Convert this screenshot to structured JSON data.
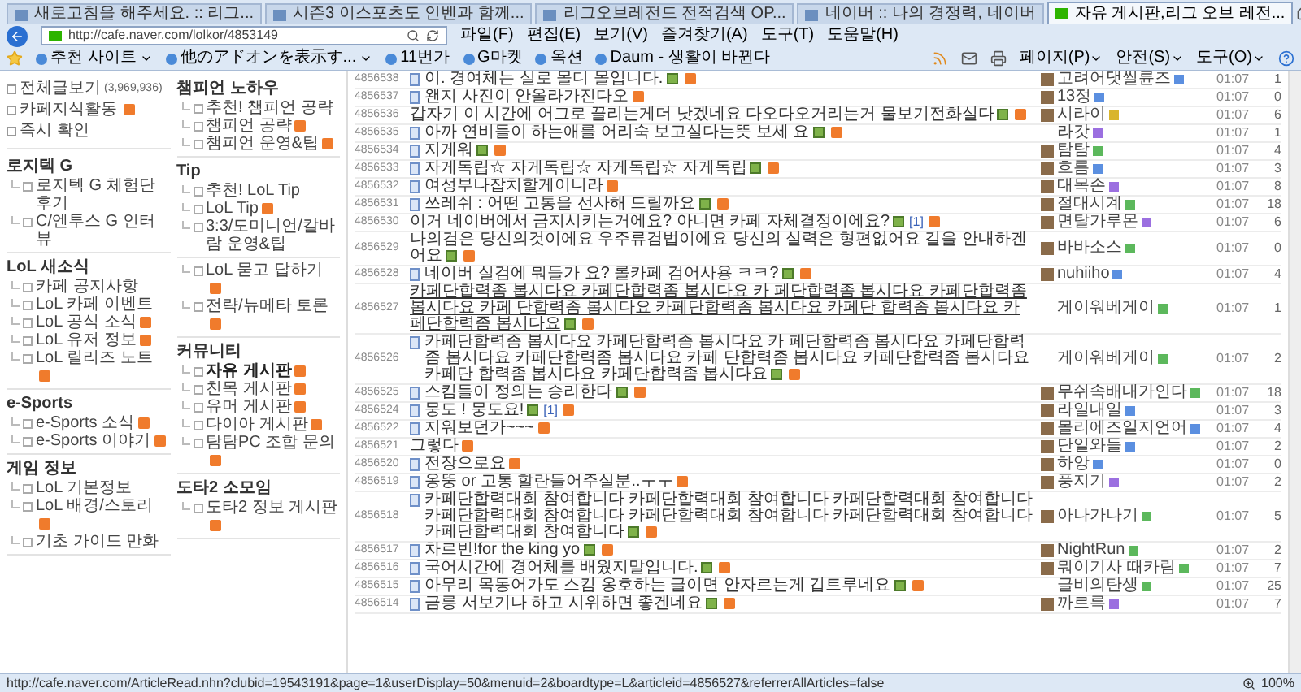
{
  "browser": {
    "tabs": [
      {
        "title": "새로고침을 해주세요. :: 리그...",
        "selected": false
      },
      {
        "title": "시즌3 이스포츠도 인벤과 함께...",
        "selected": false
      },
      {
        "title": "리그오브레전드 전적검색 OP...",
        "selected": false
      },
      {
        "title": "네이버 :: 나의 경쟁력, 네이버",
        "selected": false
      },
      {
        "title": "자유 게시판,리그 오브 레전...",
        "selected": true
      }
    ],
    "address": "http://cafe.naver.com/lolkor/4853149",
    "menu": [
      "파일(F)",
      "편집(E)",
      "보기(V)",
      "즐겨찾기(A)",
      "도구(T)",
      "도움말(H)"
    ],
    "favorites": [
      {
        "label": "추천 사이트",
        "dropdown": true
      },
      {
        "label": "他のアドオンを表示す...",
        "dropdown": true
      },
      {
        "label": "11번가",
        "dropdown": false
      },
      {
        "label": "G마켓",
        "dropdown": false
      },
      {
        "label": "옥션",
        "dropdown": false
      },
      {
        "label": "Daum - 생활이 바뀐다",
        "dropdown": false
      }
    ],
    "tools": [
      "페이지(P)",
      "안전(S)",
      "도구(O)"
    ]
  },
  "sidebar": {
    "top": [
      {
        "label": "전체글보기",
        "count": "(3,969,936)",
        "new": false
      },
      {
        "label": "카페지식활동",
        "new": true
      },
      {
        "label": "즉시 확인",
        "new": false
      }
    ],
    "groups": [
      {
        "title": "로지텍 G",
        "items": [
          {
            "label": "로지텍 G 체험단 후기",
            "new": false,
            "selected": false
          },
          {
            "label": "C/엔투스 G 인터뷰",
            "new": false,
            "selected": false
          }
        ]
      },
      {
        "title": "LoL 새소식",
        "items": [
          {
            "label": "카페 공지사항",
            "new": false,
            "selected": false
          },
          {
            "label": "LoL 카페 이벤트",
            "new": false,
            "selected": false
          },
          {
            "label": "LoL 공식 소식",
            "new": true,
            "selected": false
          },
          {
            "label": "LoL 유저 정보",
            "new": true,
            "selected": false
          },
          {
            "label": "LoL 릴리즈 노트",
            "new": true,
            "selected": false
          }
        ]
      },
      {
        "title": "e-Sports",
        "items": [
          {
            "label": "e-Sports 소식",
            "new": true,
            "selected": false
          },
          {
            "label": "e-Sports 이야기",
            "new": true,
            "selected": false
          }
        ]
      },
      {
        "title": "게임 정보",
        "items": [
          {
            "label": "LoL 기본정보",
            "new": false,
            "selected": false
          },
          {
            "label": "LoL 배경/스토리",
            "new": true,
            "selected": false
          },
          {
            "label": "기초 가이드 만화",
            "new": false,
            "selected": false
          }
        ]
      },
      {
        "title": "챔피언 노하우",
        "items": [
          {
            "label": "추천! 챔피언 공략",
            "new": false,
            "selected": false
          },
          {
            "label": "챔피언 공략",
            "new": true,
            "selected": false
          },
          {
            "label": "챔피언 운영&팁",
            "new": true,
            "selected": false
          }
        ]
      },
      {
        "title": "Tip",
        "items": [
          {
            "label": "추천! LoL Tip",
            "new": false,
            "selected": false
          },
          {
            "label": "LoL Tip",
            "new": true,
            "selected": false
          },
          {
            "label": "3:3/도미니언/칼바람 운영&팁",
            "new": false,
            "selected": false
          }
        ]
      },
      {
        "items": [
          {
            "label": "LoL 묻고 답하기",
            "new": true,
            "selected": false
          },
          {
            "label": "전략/뉴메타 토론",
            "new": true,
            "selected": false
          }
        ]
      },
      {
        "title": "커뮤니티",
        "items": [
          {
            "label": "자유 게시판",
            "new": true,
            "selected": true
          },
          {
            "label": "친목 게시판",
            "new": true,
            "selected": false
          },
          {
            "label": "유머 게시판",
            "new": true,
            "selected": false
          },
          {
            "label": "다이아 게시판",
            "new": true,
            "selected": false
          },
          {
            "label": "탐탐PC 조합 문의",
            "new": true,
            "selected": false
          }
        ]
      },
      {
        "title": "도타2 소모임",
        "items": [
          {
            "label": "도타2 정보 게시판",
            "new": true,
            "selected": false
          }
        ]
      }
    ]
  },
  "rows": [
    {
      "id": "4856538",
      "doc_icon": true,
      "title": "이. 경여체는 실로 몰디 몰입니다.",
      "image": true,
      "new": true,
      "hovered": false,
      "author": "고려어댓씰륜즈",
      "avatar": true,
      "color": "#5b8fe0",
      "date": "01:07",
      "views": "1"
    },
    {
      "id": "4856537",
      "doc_icon": true,
      "title": "왠지 사진이 안올라가진다오",
      "image": false,
      "new": true,
      "hovered": false,
      "author": "13정",
      "avatar": true,
      "color": "#5b8fe0",
      "date": "01:07",
      "views": "0"
    },
    {
      "id": "4856536",
      "doc_icon": false,
      "title": "갑자기 이 시간에 어그로 끌리는게더 낫겠네요 다오다오거리는거 물보기전화실다",
      "image": true,
      "new": true,
      "hovered": false,
      "author": "시라이",
      "avatar": true,
      "color": "#d9b52c",
      "date": "01:07",
      "views": "6"
    },
    {
      "id": "4856535",
      "doc_icon": true,
      "title": "아까 연비들이 하는애를 어리숙 보고실다는뜻 보세 요",
      "image": true,
      "new": true,
      "hovered": false,
      "author": "라갓",
      "avatar": false,
      "color": "#9b6fe0",
      "date": "01:07",
      "views": "1"
    },
    {
      "id": "4856534",
      "doc_icon": true,
      "title": "지게워",
      "image": true,
      "new": true,
      "hovered": false,
      "author": "탐탐",
      "avatar": true,
      "color": "#5cb85c",
      "date": "01:07",
      "views": "4"
    },
    {
      "id": "4856533",
      "doc_icon": true,
      "title": "자게독립☆ 자게독립☆ 자게독립☆ 자게독립",
      "image": true,
      "new": true,
      "hovered": false,
      "author": "흐름",
      "avatar": true,
      "color": "#5b8fe0",
      "date": "01:07",
      "views": "3"
    },
    {
      "id": "4856532",
      "doc_icon": true,
      "title": "여성부나잡치할게이니라",
      "image": false,
      "new": true,
      "hovered": false,
      "author": "대목손",
      "avatar": true,
      "color": "#9b6fe0",
      "date": "01:07",
      "views": "8"
    },
    {
      "id": "4856531",
      "doc_icon": true,
      "title": "쓰레쉬 : 어떤 고통을 선사해 드릴까요",
      "image": true,
      "new": true,
      "hovered": false,
      "author": "절대시계",
      "avatar": true,
      "color": "#5cb85c",
      "date": "01:07",
      "views": "18"
    },
    {
      "id": "4856530",
      "doc_icon": false,
      "title": "이거 네이버에서 금지시키는거에요? 아니면 카페 자체결정이에요?",
      "image": true,
      "comments": "[1]",
      "new": true,
      "hovered": false,
      "author": "면탈가루몬",
      "avatar": true,
      "color": "#9b6fe0",
      "date": "01:07",
      "views": "6"
    },
    {
      "id": "4856529",
      "doc_icon": false,
      "title": "나의검은 당신의것이에요 우주류검법이에요 당신의 실력은 형편없어요 길을 안내하겐어요",
      "image": true,
      "new": true,
      "hovered": false,
      "author": "바바소스",
      "avatar": true,
      "color": "#5cb85c",
      "date": "01:07",
      "views": "0"
    },
    {
      "id": "4856528",
      "doc_icon": true,
      "title": "네이버 실검에 뭐들가 요? 롤카페 검어사용 ㅋㅋ?",
      "image": true,
      "new": true,
      "hovered": false,
      "author": "nuhiiho",
      "avatar": true,
      "color": "#5b8fe0",
      "date": "01:07",
      "views": "4"
    },
    {
      "id": "4856527",
      "doc_icon": false,
      "title": "카페단합력좀 봅시다요 카페단합력좀 봅시다요 카 페단합력좀 봅시다요 카페단합력좀 봅시다요 카페 단합력좀 봅시다요 카페단합력좀 봅시다요 카페단 합력좀 봅시다요 카페단합력좀 봅시다요",
      "image": true,
      "new": true,
      "hovered": true,
      "author": "게이워베게이",
      "avatar": false,
      "color": "#5cb85c",
      "date": "01:07",
      "views": "1"
    },
    {
      "id": "4856526",
      "doc_icon": true,
      "title": "카페단합력좀 봅시다요 카페단합력좀 봅시다요 카 페단합력좀 봅시다요 카페단합력좀 봅시다요 카페단합력좀 봅시다요 카페 단합력좀 봅시다요 카페단합력좀 봅시다요 카페단 합력좀 봅시다요 카페단합력좀 봅시다요",
      "image": true,
      "new": true,
      "hovered": false,
      "author": "게이워베게이",
      "avatar": false,
      "color": "#5cb85c",
      "date": "01:07",
      "views": "2"
    },
    {
      "id": "4856525",
      "doc_icon": true,
      "title": "스킴들이 정의는 승리한다",
      "image": true,
      "new": true,
      "hovered": false,
      "author": "무쉬속배내가인다",
      "avatar": true,
      "color": "#5cb85c",
      "date": "01:07",
      "views": "18"
    },
    {
      "id": "4856524",
      "doc_icon": true,
      "title": "뭉도 ! 뭉도요!",
      "image": true,
      "comments": "[1]",
      "new": true,
      "hovered": false,
      "author": "라일내일",
      "avatar": true,
      "color": "#5b8fe0",
      "date": "01:07",
      "views": "3"
    },
    {
      "id": "4856522",
      "doc_icon": true,
      "title": "지워보던가~~~",
      "image": false,
      "new": true,
      "hovered": false,
      "author": "몰리에즈일지언어",
      "avatar": true,
      "color": "#5b8fe0",
      "date": "01:07",
      "views": "4"
    },
    {
      "id": "4856521",
      "doc_icon": false,
      "title": "그렇다",
      "image": false,
      "new": true,
      "hovered": false,
      "author": "단일와들",
      "avatar": true,
      "color": "#5b8fe0",
      "date": "01:07",
      "views": "2"
    },
    {
      "id": "4856520",
      "doc_icon": true,
      "title": "전장으로요",
      "image": false,
      "new": true,
      "hovered": false,
      "author": "하앙",
      "avatar": true,
      "color": "#5b8fe0",
      "date": "01:07",
      "views": "0"
    },
    {
      "id": "4856519",
      "doc_icon": true,
      "title": "옹뚱 or 고통 할란들어주실분..ㅜㅜ",
      "image": false,
      "new": true,
      "hovered": false,
      "author": "풍지기",
      "avatar": true,
      "color": "#9b6fe0",
      "date": "01:07",
      "views": "2"
    },
    {
      "id": "4856518",
      "doc_icon": true,
      "title": "카페단합력대회 참여합니다 카페단합력대회 참여합니다 카페단합력대회 참여합니다 카페단합력대회 참여합니다 카페단합력대회 참여합니다 카페단합력대회 참여합니다 카페단합력대회 참여합니다",
      "image": true,
      "new": true,
      "hovered": false,
      "author": "아나가나기",
      "avatar": true,
      "color": "#5cb85c",
      "date": "01:07",
      "views": "5"
    },
    {
      "id": "4856517",
      "doc_icon": true,
      "title": "차르빈!for the king yo",
      "image": true,
      "new": true,
      "hovered": false,
      "author": "NightRun",
      "avatar": true,
      "color": "#5cb85c",
      "date": "01:07",
      "views": "2"
    },
    {
      "id": "4856516",
      "doc_icon": true,
      "title": "국어시간에 경어체를 배웠지말입니다.",
      "image": true,
      "new": true,
      "hovered": false,
      "author": "뭐이기사 때카림",
      "avatar": true,
      "color": "#5cb85c",
      "date": "01:07",
      "views": "7"
    },
    {
      "id": "4856515",
      "doc_icon": true,
      "title": "아무리 목동어가도 스킴 옹호하는 글이면 안자르는게 깁트루네요",
      "image": true,
      "new": true,
      "hovered": false,
      "author": "글비의탄생",
      "avatar": false,
      "color": "#5cb85c",
      "date": "01:07",
      "views": "25"
    },
    {
      "id": "4856514",
      "doc_icon": true,
      "title": "금릉 서보기나 하고 시위하면 좋겐네요",
      "image": true,
      "new": true,
      "hovered": false,
      "author": "까르륵",
      "avatar": true,
      "color": "#9b6fe0",
      "date": "01:07",
      "views": "7"
    }
  ],
  "status_bar": {
    "url": "http://cafe.naver.com/ArticleRead.nhn?clubid=19543191&page=1&userDisplay=50&menuid=2&boardtype=L&articleid=4856527&referrerAllArticles=false",
    "zoom": "100%"
  }
}
